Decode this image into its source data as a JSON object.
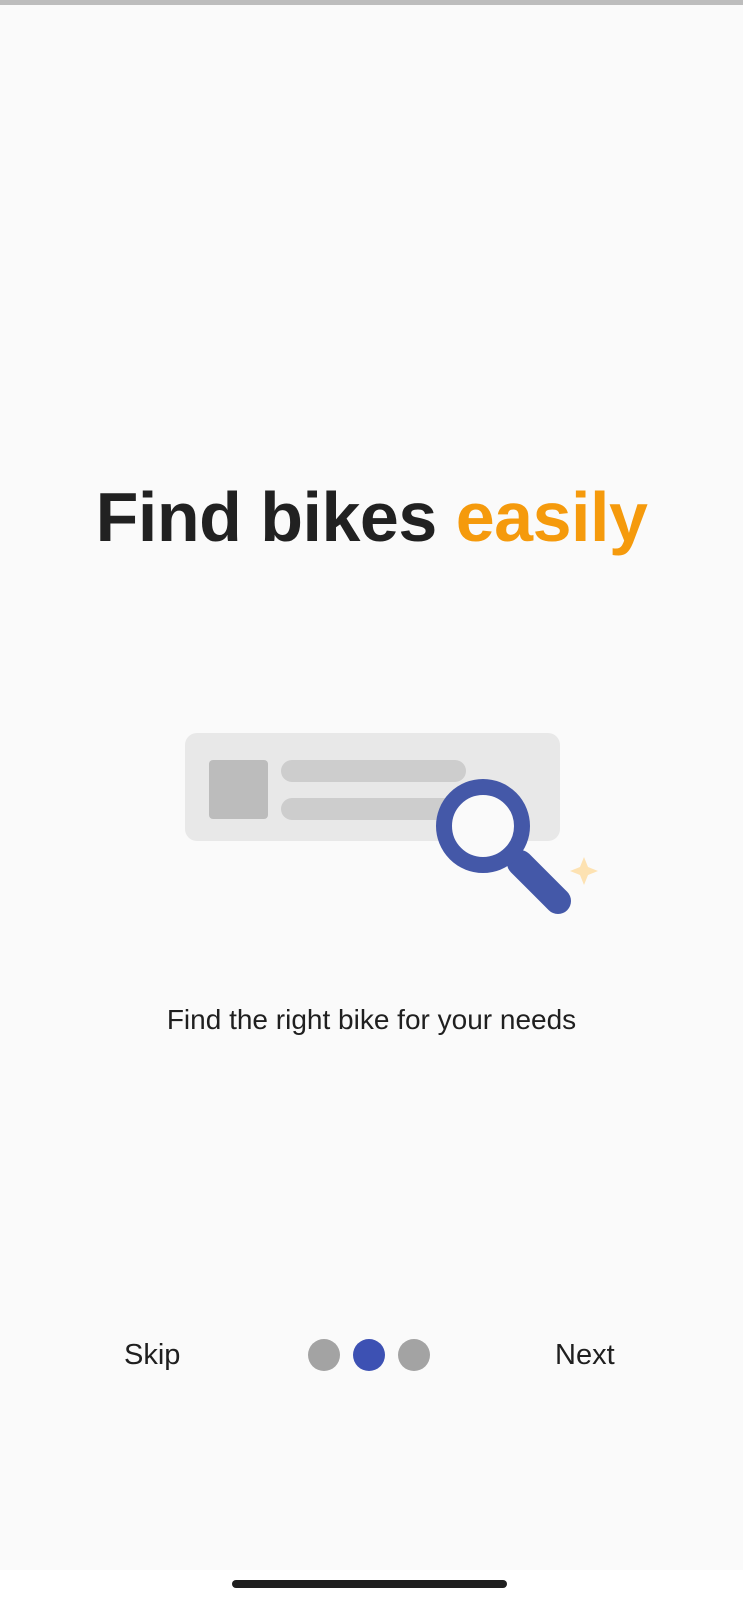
{
  "onboarding": {
    "headline_main": "Find bikes ",
    "headline_accent": "easily",
    "subtitle": "Find the right bike for your needs",
    "skip_label": "Skip",
    "next_label": "Next",
    "page_indicator": {
      "total": 3,
      "current": 2
    }
  },
  "illustration": {
    "icon": "magnifier-search-icon",
    "sparkle_icon": "sparkle-icon"
  },
  "colors": {
    "accent": "#f59a0c",
    "primary": "#3d51b3",
    "text": "#212121",
    "inactive_dot": "#a3a3a3",
    "background": "#fafafa"
  }
}
